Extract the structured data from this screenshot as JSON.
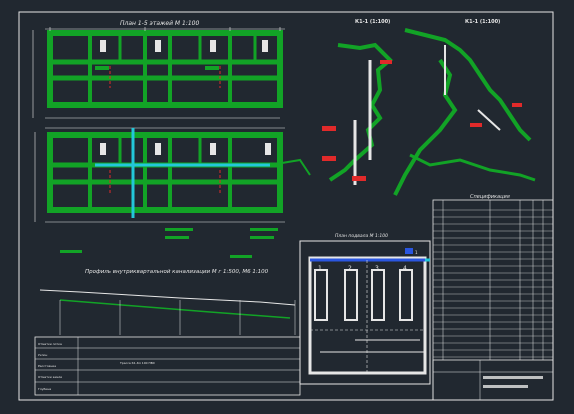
{
  "drawing": {
    "plan_title": "План 1-5 этажей  М 1:100",
    "profile_title": "Профиль внутриквартальной канализации  М г 1:500, М6 1:100",
    "iso1_title": "К1-1 (1:100)",
    "iso2_title": "К1-1 (1:100)",
    "spec_title": "Спецификация",
    "basement_title": "План подвала  М 1:100",
    "profile_bottom_title": "Трасса К1-Кл 100 ПВХ",
    "profile_rows": [
      "Отметки лотка",
      "Уклон",
      "Расстояние",
      "Отметки земли",
      "Глубина"
    ],
    "room_numbers": [
      "1",
      "2",
      "3",
      "4"
    ],
    "basement_tag": "1"
  },
  "colors": {
    "background": "#212830",
    "wall_green": "#12a326",
    "pipe_cyan": "#23c7d9",
    "line_white": "#e6e6e6",
    "mark_red": "#e12a2a",
    "pipe_blue": "#2a56e0"
  }
}
